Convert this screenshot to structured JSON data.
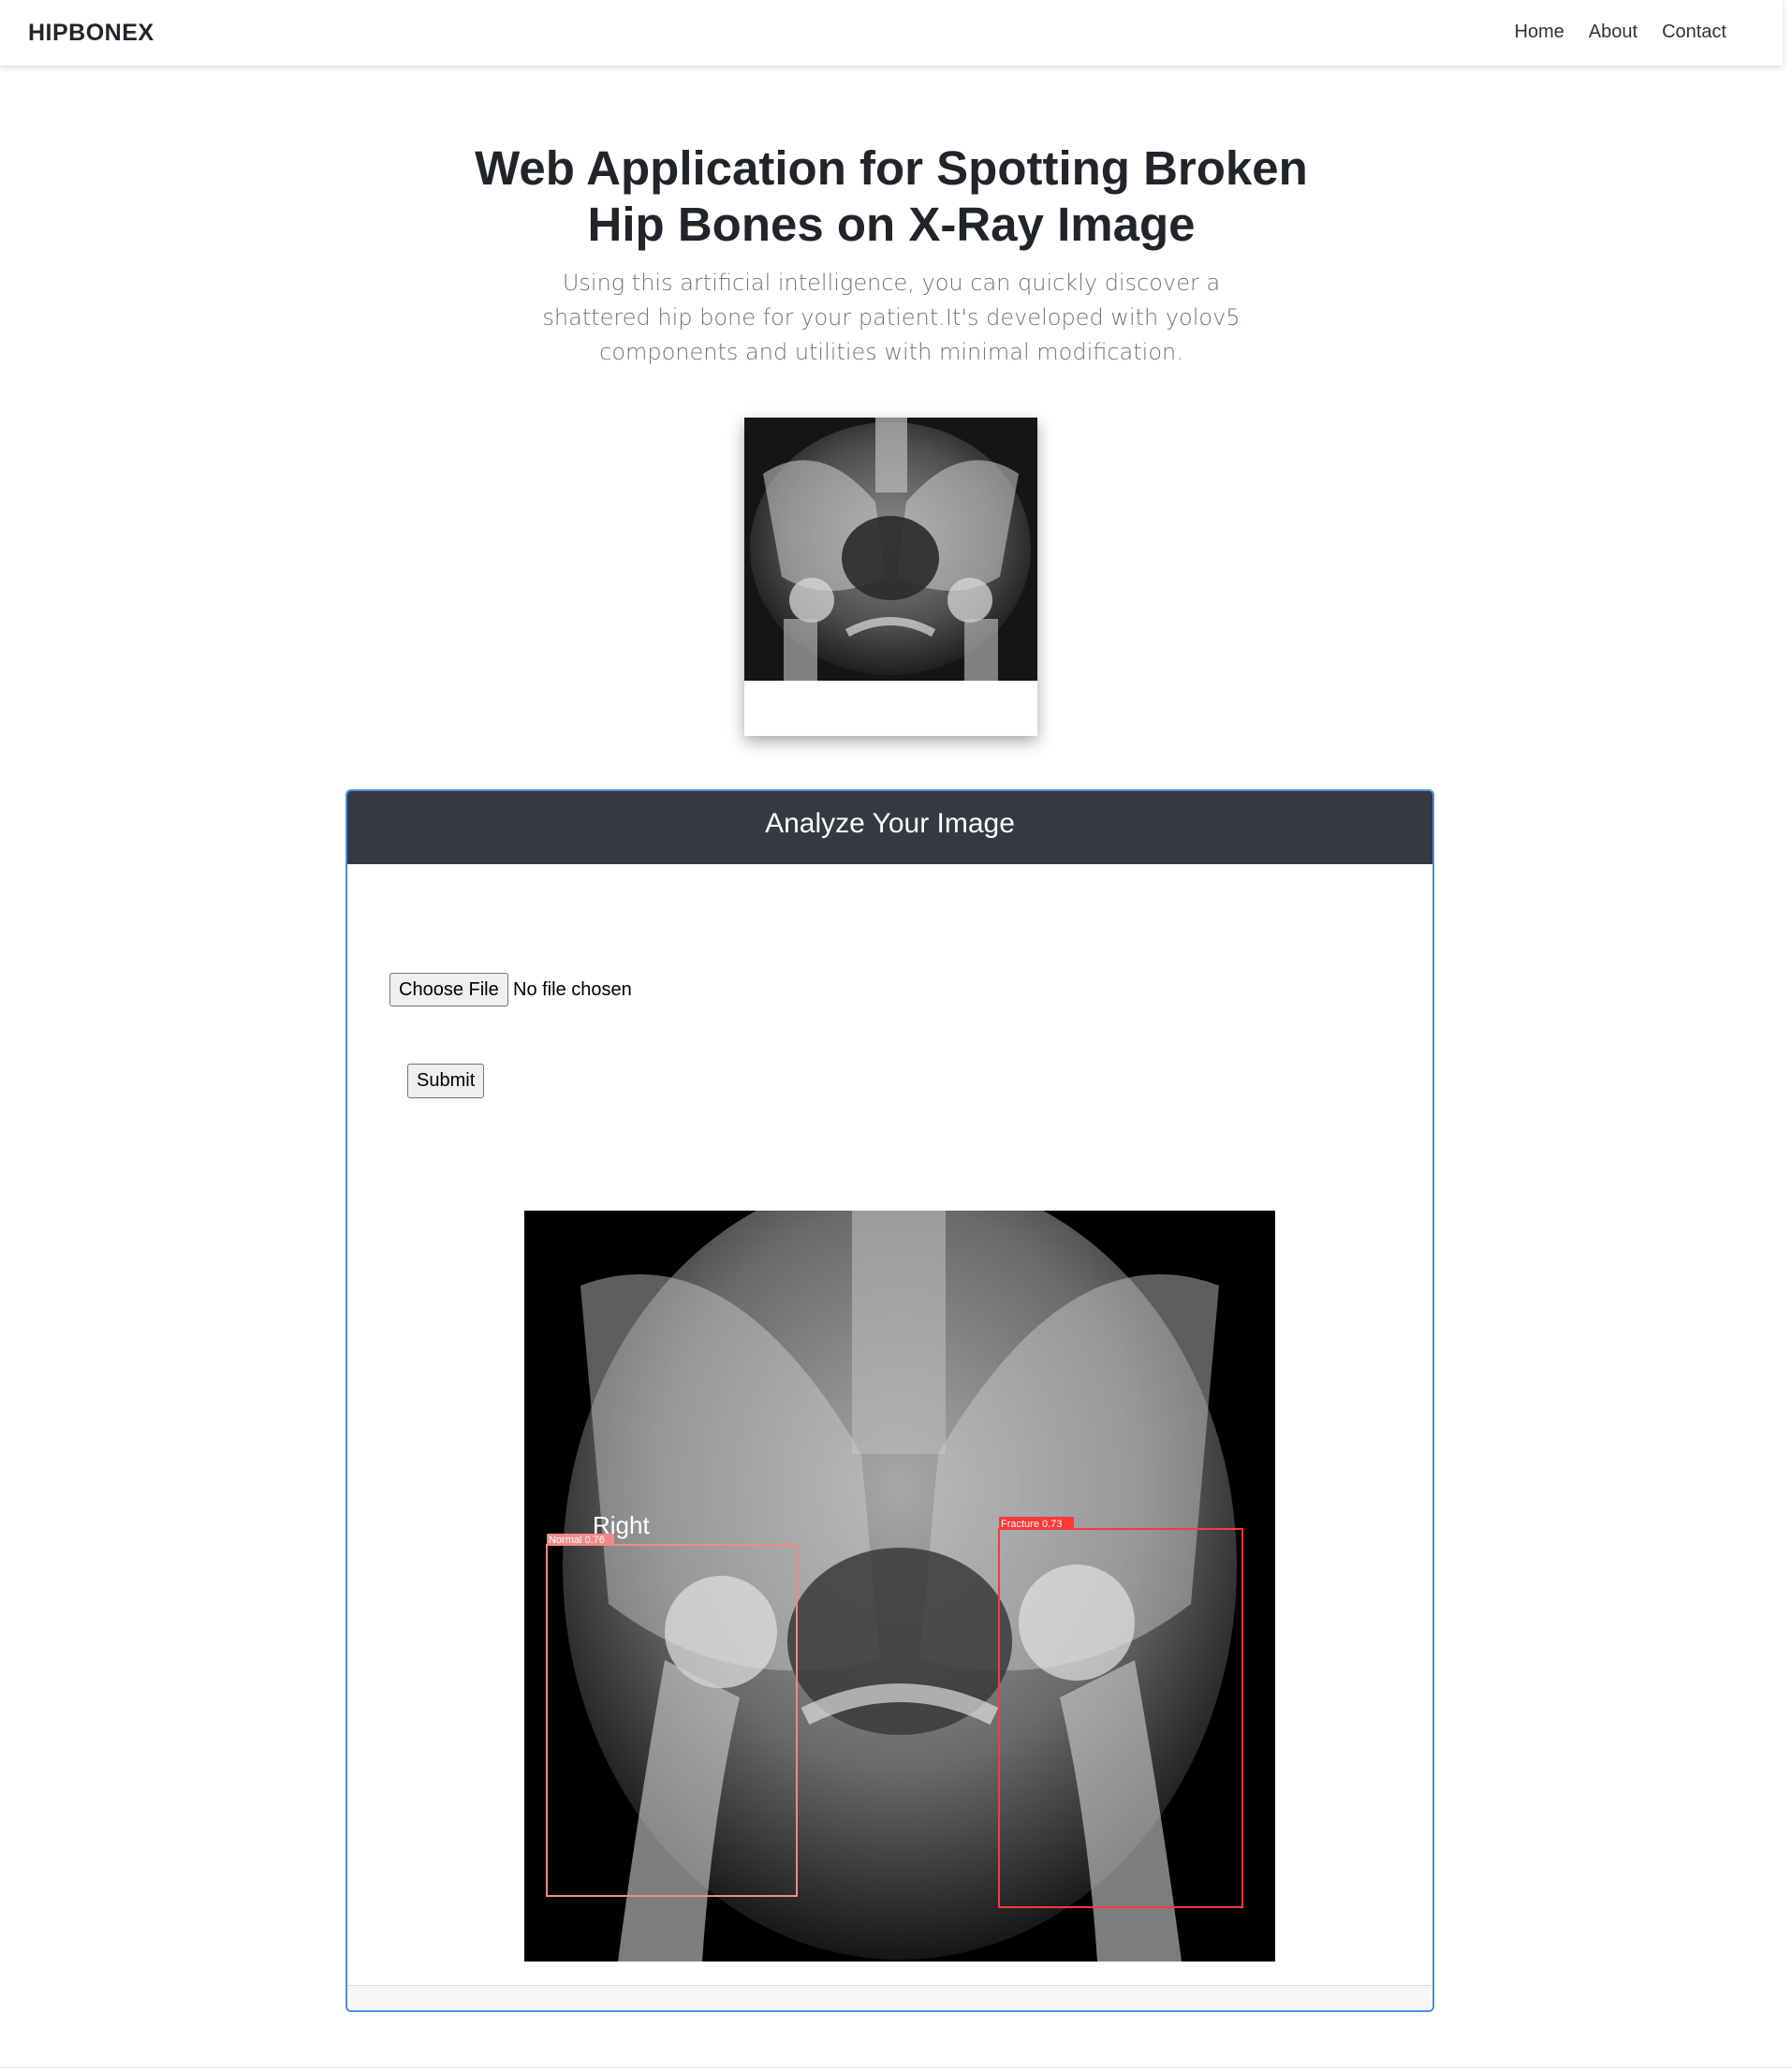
{
  "navbar": {
    "brand": "HIPBONEX",
    "links": [
      "Home",
      "About",
      "Contact"
    ]
  },
  "hero": {
    "title": "Web Application for Spotting Broken Hip Bones on X-Ray Image",
    "subtitle": "Using this artificial intelligence, you can quickly discover a shattered hip bone for your patient.It's developed with yolov5 components and utilities with minimal modification."
  },
  "analyze": {
    "title": "Analyze Your Image",
    "choose_file_label": "Choose File",
    "file_status": "No file chosen",
    "submit_label": "Submit",
    "result": {
      "side_label": "Right",
      "detections": [
        {
          "label": "Normal 0.76",
          "color": "#f08a8a"
        },
        {
          "label": "Fracture 0.73",
          "color": "#ff3838"
        }
      ]
    }
  },
  "icons": {
    "thumbnail": "pelvis-xray-thumbnail",
    "result": "pelvis-xray-detection-result"
  }
}
